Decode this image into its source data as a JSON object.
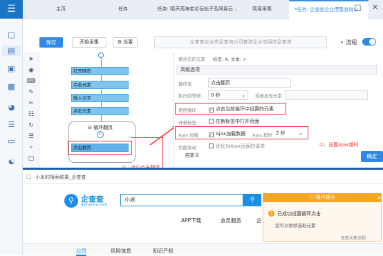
{
  "app": {
    "logo": "☰"
  },
  "tabs": [
    "主页",
    "任务",
    "任务: 晴天雨海老论坛帖子及网易云...",
    "简易采集",
    "*任务: 企查查企业信息查询公..."
  ],
  "window": {
    "min": "—",
    "max": "□",
    "close": "✕"
  },
  "toolbar": {
    "save": "保存",
    "start": "开始采集",
    "settings": "设置",
    "url": "企查查企业信息查询公司查询企业信用信息查询",
    "flow": "流程"
  },
  "flow": {
    "steps": [
      "打开网页",
      "点击元素",
      "输入文字",
      "点击元素"
    ],
    "loop_label": "循环翻页",
    "loop_step": "点击翻页",
    "annotation1": "①、选中点击翻页"
  },
  "props": {
    "current_label": "要点击的元素",
    "current_value": "标签: A, 文本: >",
    "advanced": "高级选项",
    "op_name_label": "操作名",
    "op_name": "点击翻页",
    "wait_label": "执行前等待",
    "wait_value": "0 秒",
    "or_label": "或者出现元素",
    "loop_label": "使用循环",
    "loop_check": "点击当前循环中设置的元素",
    "newtab_label": "开新标签",
    "newtab_check": "在新标签中打开页面",
    "ajax_label": "Ajax 加载",
    "ajax_check": "Ajax加载数据",
    "ajax_timeout_label": "Ajax 超时",
    "ajax_timeout": "2 秒",
    "scroll_label": "页面滚动",
    "scroll_check": "优化对Ajax页面的请求",
    "custom": "自定义",
    "confirm": "确定",
    "annotation2": "②、设置Ajax超时"
  },
  "browser": {
    "url": "小米的搜索结果_企查查",
    "logo_name": "企查查",
    "logo_sub": "qichacha.com",
    "search_value": "小米",
    "nav": [
      "APP下载",
      "会员服务",
      "企"
    ],
    "tabs": [
      "公司",
      "风险信息",
      "知识产权"
    ]
  },
  "popup": {
    "title": "操作提示",
    "msg1": "已成功设置循环点击",
    "msg2": "您可以继续选取元素",
    "link": "查看采集流程"
  }
}
